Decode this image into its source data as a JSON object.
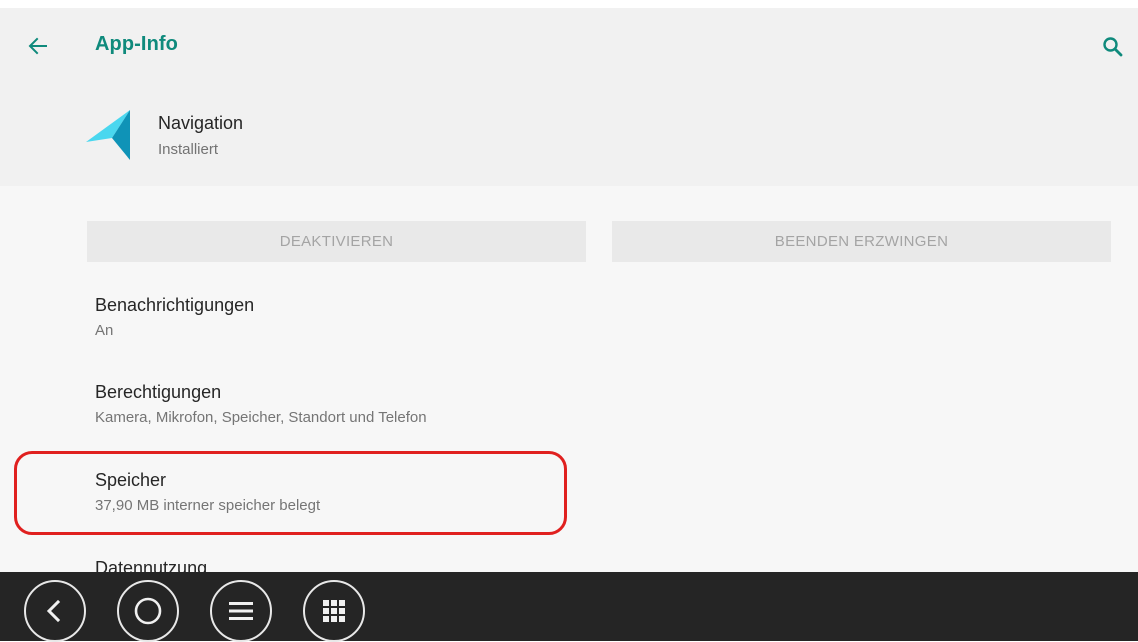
{
  "header": {
    "title": "App-Info",
    "back_icon": "arrow-left-icon",
    "search_icon": "search-icon"
  },
  "app": {
    "name": "Navigation",
    "status": "Installiert",
    "icon": "navigation-arrow-icon"
  },
  "buttons": {
    "deactivate": "DEAKTIVIEREN",
    "force_stop": "BEENDEN ERZWINGEN"
  },
  "prefs": [
    {
      "title": "Benachrichtigungen",
      "summary": "An"
    },
    {
      "title": "Berechtigungen",
      "summary": "Kamera, Mikrofon, Speicher, Standort und Telefon"
    },
    {
      "title": "Speicher",
      "summary": "37,90 MB interner speicher belegt"
    },
    {
      "title": "Datennutzung",
      "summary": ""
    }
  ],
  "navbar": {
    "icons": [
      "back-icon",
      "home-icon",
      "menu-icon",
      "apps-grid-icon"
    ]
  },
  "colors": {
    "accent": "#0f8a7c",
    "highlight": "#e0201f",
    "navbar": "#252525"
  }
}
